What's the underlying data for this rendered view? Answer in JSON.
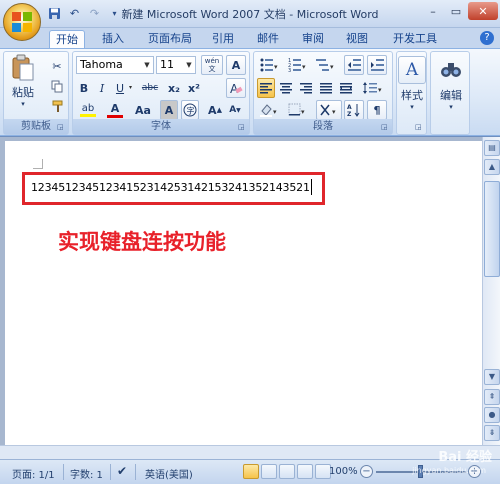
{
  "window": {
    "title": "新建 Microsoft Word 2007 文档 - Microsoft Word"
  },
  "tabs": [
    "开始",
    "插入",
    "页面布局",
    "引用",
    "邮件",
    "审阅",
    "视图",
    "开发工具"
  ],
  "ribbon": {
    "clipboard": {
      "label": "剪贴板",
      "paste_label": "粘贴"
    },
    "font": {
      "label": "字体",
      "font_name": "Tahoma",
      "font_size": "11",
      "bold": "B",
      "italic": "I",
      "underline": "U",
      "strike": "abc",
      "subscript": "x₂",
      "superscript": "x²",
      "font_color_glyph": "A",
      "change_case": "Aa",
      "grow": "A",
      "shrink": "A",
      "clear_format": "A",
      "char_border": "A",
      "wen": "wén"
    },
    "paragraph": {
      "label": "段落"
    },
    "styles": {
      "label": "样式"
    },
    "editing": {
      "label": "编辑"
    }
  },
  "document": {
    "typed_text": "12345123451234152314253142153241352143521",
    "annotation": "实现键盘连按功能"
  },
  "statusbar": {
    "page": "页面: 1/1",
    "words": "字数: 1",
    "language": "英语(美国)",
    "zoom": "100%"
  },
  "watermark": {
    "brand": "Bai 经验",
    "url": "jingyan.baidu.com"
  },
  "colors": {
    "accent": "#15428b",
    "annotation_red": "#e8212a",
    "box_red": "#e0262b",
    "highlight": "#fff200",
    "font_color": "#e00000"
  }
}
